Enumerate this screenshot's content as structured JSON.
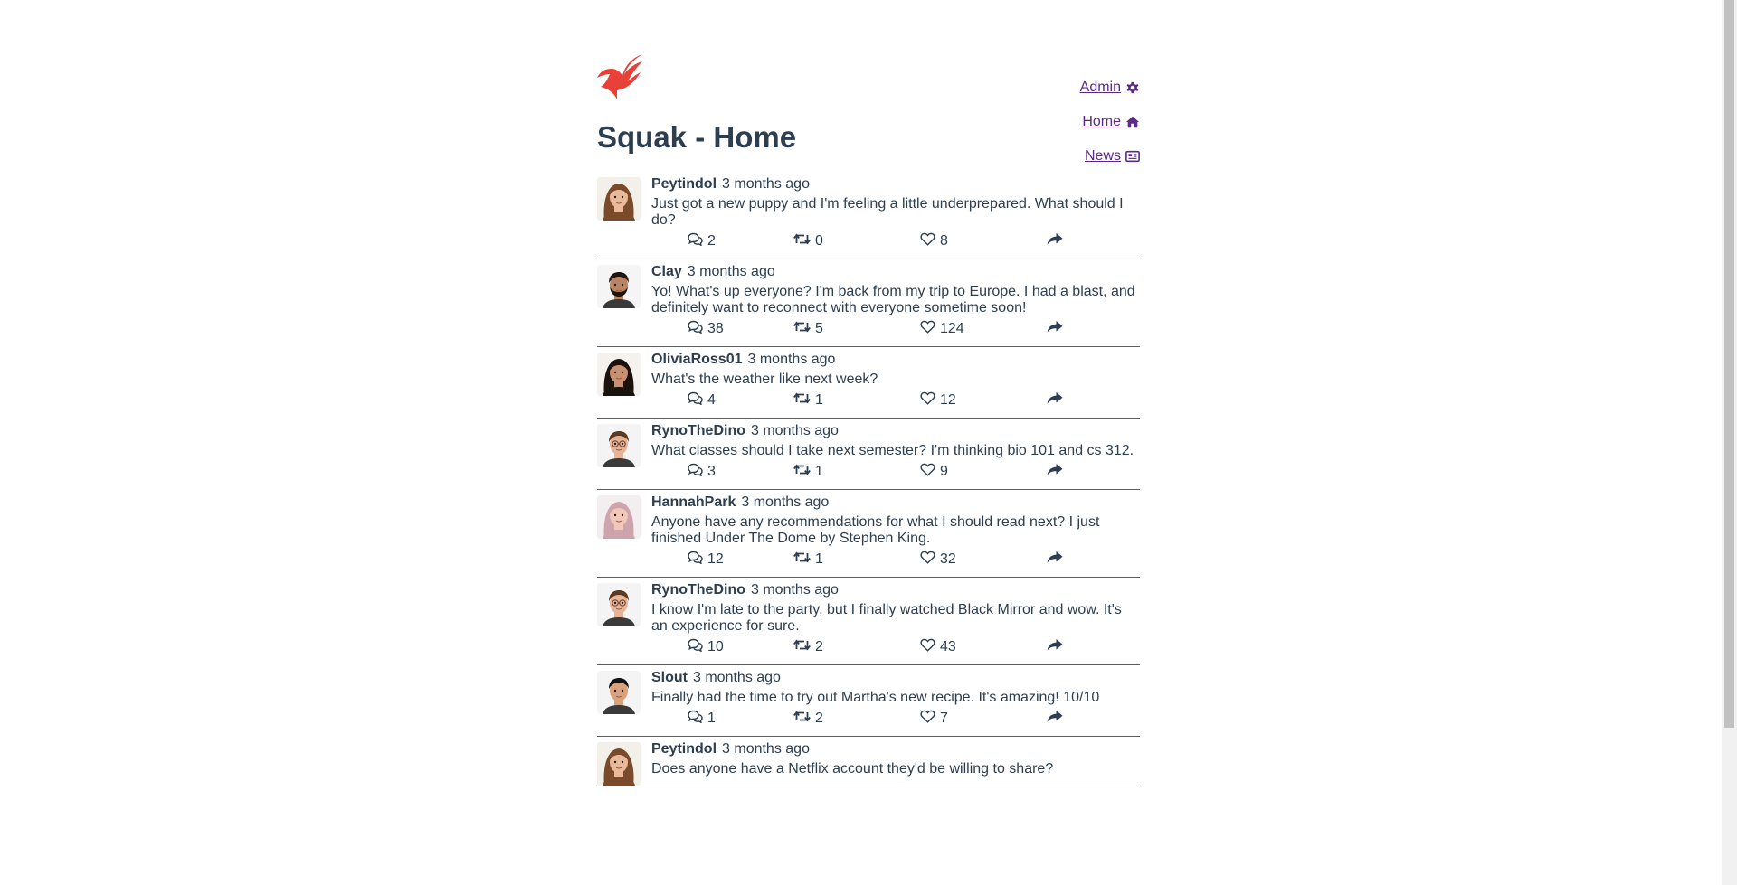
{
  "app": {
    "title": "Squak - Home"
  },
  "nav": [
    {
      "label": "Admin",
      "icon": "gear-icon"
    },
    {
      "label": "Home",
      "icon": "home-icon"
    },
    {
      "label": "News",
      "icon": "newspaper-icon"
    }
  ],
  "colors": {
    "text": "#2c3e50",
    "link": "#5b2a86",
    "brand": "#e8413a"
  },
  "posts": [
    {
      "user": "Peytindol",
      "time": "3 months ago",
      "text": "Just got a new puppy and I'm feeling a little underprepared. What should I do?",
      "comments": "2",
      "reposts": "0",
      "likes": "8",
      "avatar": "woman-brown-hair"
    },
    {
      "user": "Clay",
      "time": "3 months ago",
      "text": "Yo! What's up everyone? I'm back from my trip to Europe. I had a blast, and definitely want to reconnect with everyone sometime soon!",
      "comments": "38",
      "reposts": "5",
      "likes": "124",
      "avatar": "man-beard"
    },
    {
      "user": "OliviaRoss01",
      "time": "3 months ago",
      "text": "What's the weather like next week?",
      "comments": "4",
      "reposts": "1",
      "likes": "12",
      "avatar": "woman-dark-hair"
    },
    {
      "user": "RynoTheDino",
      "time": "3 months ago",
      "text": "What classes should I take next semester? I'm thinking bio 101 and cs 312.",
      "comments": "3",
      "reposts": "1",
      "likes": "9",
      "avatar": "man-glasses"
    },
    {
      "user": "HannahPark",
      "time": "3 months ago",
      "text": "Anyone have any recommendations for what I should read next? I just finished Under The Dome by Stephen King.",
      "comments": "12",
      "reposts": "1",
      "likes": "32",
      "avatar": "woman-pink-hair"
    },
    {
      "user": "RynoTheDino",
      "time": "3 months ago",
      "text": "I know I'm late to the party, but I finally watched Black Mirror and wow. It's an experience for sure.",
      "comments": "10",
      "reposts": "2",
      "likes": "43",
      "avatar": "man-glasses"
    },
    {
      "user": "Slout",
      "time": "3 months ago",
      "text": "Finally had the time to try out Martha's new recipe. It's amazing! 10/10",
      "comments": "1",
      "reposts": "2",
      "likes": "7",
      "avatar": "man-short-hair"
    },
    {
      "user": "Peytindol",
      "time": "3 months ago",
      "text": "Does anyone have a Netflix account they'd be willing to share?",
      "comments": "",
      "reposts": "",
      "likes": "",
      "avatar": "woman-brown-hair"
    }
  ]
}
